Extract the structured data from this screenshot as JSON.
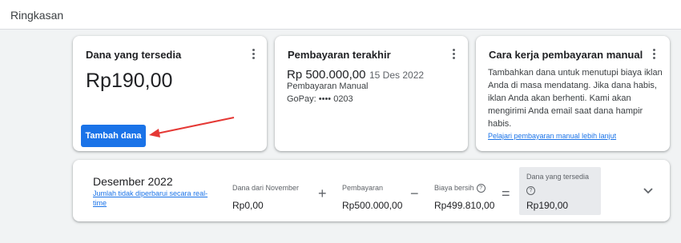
{
  "header": {
    "title": "Ringkasan"
  },
  "available_card": {
    "title": "Dana yang tersedia",
    "amount": "Rp190,00",
    "button_label": "Tambah dana"
  },
  "last_payment_card": {
    "title": "Pembayaran terakhir",
    "amount": "Rp 500.000,00",
    "date": "15 Des 2022",
    "method": "Pembayaran Manual",
    "account": "GoPay: •••• 0203"
  },
  "howto_card": {
    "title": "Cara kerja pembayaran manual",
    "description": "Tambahkan dana untuk menutupi biaya iklan Anda di masa mendatang. Jika dana habis, iklan Anda akan berhenti. Kami akan mengirimi Anda email saat dana hampir habis.",
    "link": "Pelajari pembayaran manual lebih lanjut"
  },
  "summary": {
    "month": "Desember 2022",
    "note": "Jumlah tidak diperbarui secara real-time",
    "items": [
      {
        "label": "Dana dari November",
        "value": "Rp0,00"
      },
      {
        "label": "Pembayaran",
        "value": "Rp500.000,00"
      },
      {
        "label": "Biaya bersih",
        "value": "Rp499.810,00"
      },
      {
        "label": "Dana yang tersedia",
        "value": "Rp190,00"
      }
    ],
    "operators": [
      "+",
      "−",
      "="
    ]
  },
  "icons": {
    "menu": "more-vert-icon",
    "help": "help-circle-icon",
    "expand": "chevron-down-icon",
    "annotation": "red-arrow"
  },
  "colors": {
    "accent": "#1a73e8",
    "arrow": "#e53935"
  }
}
